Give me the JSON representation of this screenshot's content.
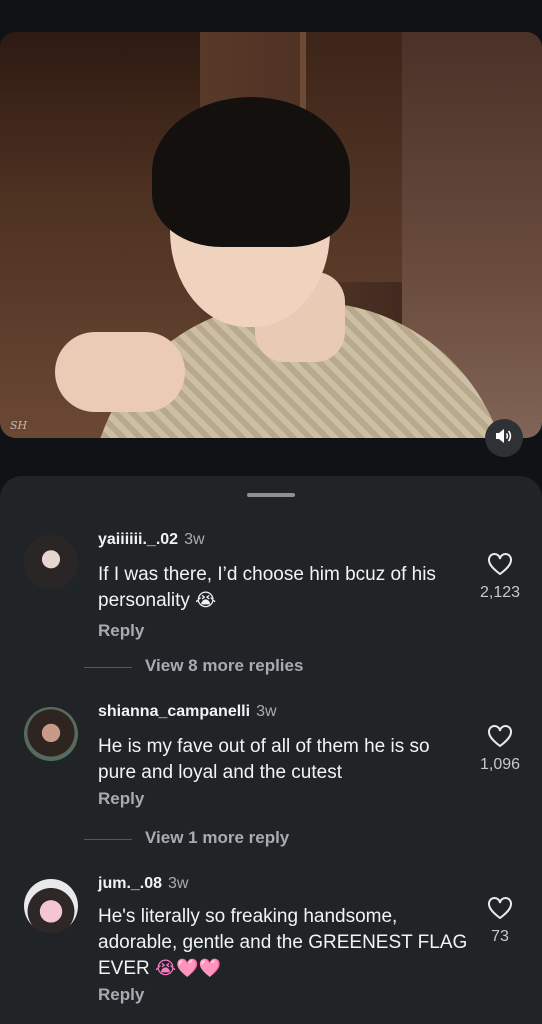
{
  "video": {
    "watermark": "SH",
    "sound_icon": "speaker-icon"
  },
  "comments": [
    {
      "username": "yaiiiiii._.02",
      "time": "3w",
      "text": "If I was there, I’d choose him bcuz of his personality",
      "emoji": "😭",
      "likes": "2,123",
      "reply_label": "Reply",
      "view_more": "View 8 more replies"
    },
    {
      "username": "shianna_campanelli",
      "time": "3w",
      "text": "He is my fave out of all of them he is so pure and loyal and the cutest",
      "emoji": "",
      "likes": "1,096",
      "reply_label": "Reply",
      "view_more": "View 1 more reply"
    },
    {
      "username": "jum._.08",
      "time": "3w",
      "text": "He's literally so freaking handsome, adorable, gentle and the GREENEST FLAG EVER",
      "emoji": "😭🩷🩷",
      "likes": "73",
      "reply_label": "Reply",
      "view_more": ""
    }
  ],
  "colors": {
    "background": "#101316",
    "sheet": "#212427",
    "secondary_text": "#a8abb0"
  }
}
